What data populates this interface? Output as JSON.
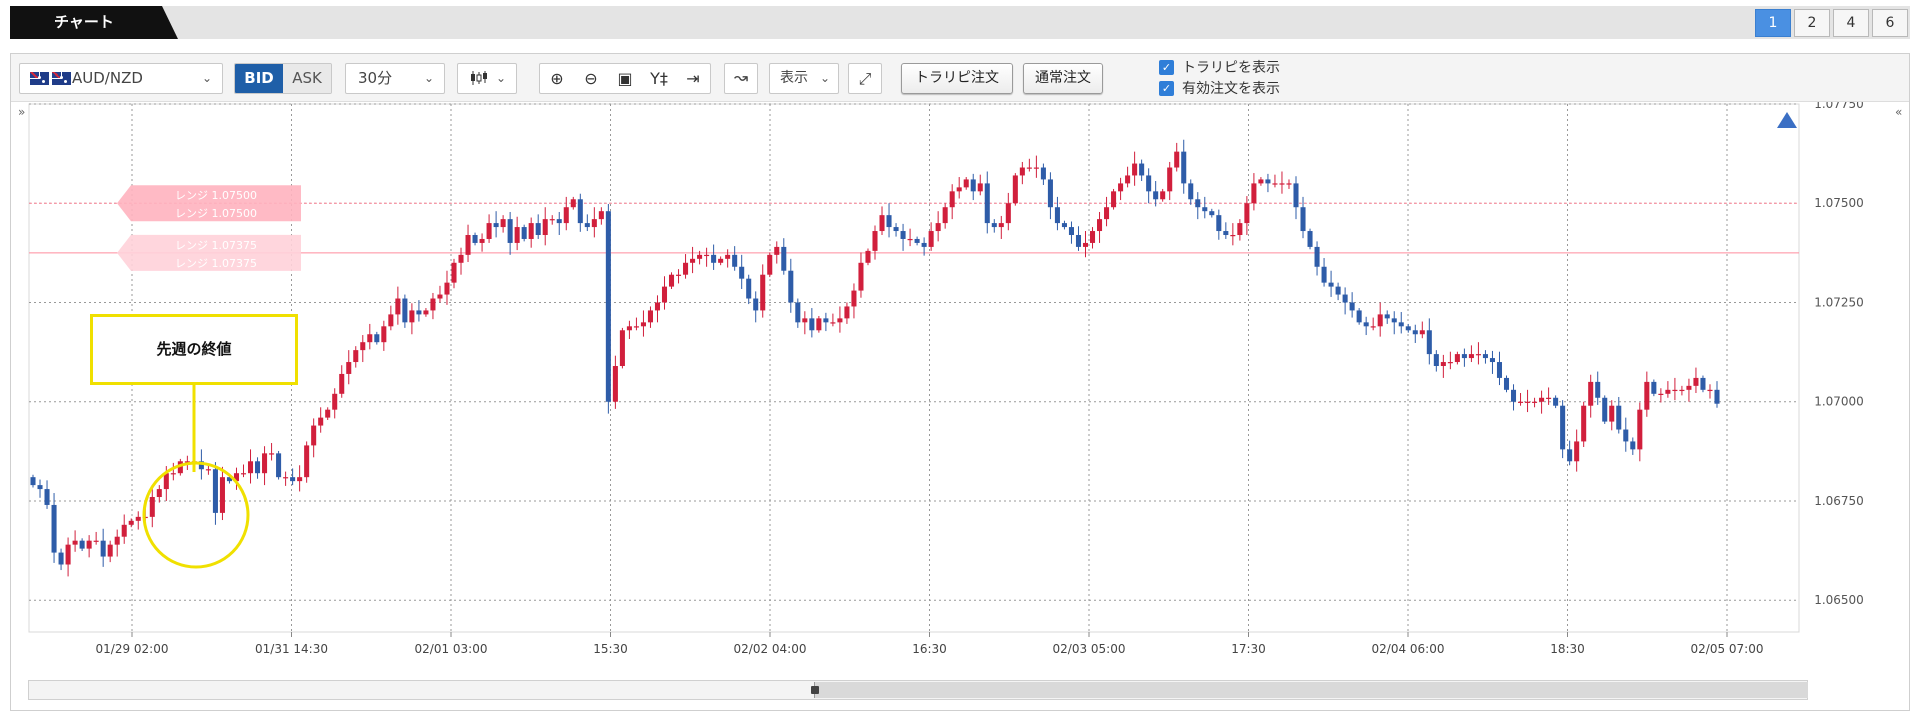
{
  "title_tab": "チャート",
  "layout_buttons": [
    "1",
    "2",
    "4",
    "6"
  ],
  "toolbar": {
    "pair": "AUD/NZD",
    "bid_label": "BID",
    "ask_label": "ASK",
    "timeframe": "30分",
    "display_label": "表示",
    "order_buttons": {
      "trail": "トラリピ注文",
      "normal": "通常注文"
    },
    "checkboxes": [
      "トラリピを表示",
      "有効注文を表示"
    ],
    "icons": [
      "zoom-in-icon",
      "zoom-out-icon",
      "fit-icon",
      "y-scale-icon",
      "jump-to-latest-icon"
    ]
  },
  "colors": {
    "up": "#d11f3c",
    "down": "#2e5ca8",
    "range_line": "#ff8c9e",
    "annotation": "#f0e000",
    "active": "#4a90e2"
  },
  "annotation": "先週の終値",
  "range_orders": [
    {
      "price": 1.075,
      "labels": [
        "レンジ 1.07500",
        "レンジ 1.07500"
      ]
    },
    {
      "price": 1.07375,
      "labels": [
        "レンジ 1.07375",
        "レンジ 1.07375"
      ]
    }
  ],
  "chart_data": {
    "type": "candlestick",
    "y_ticks": [
      "1.07750",
      "1.07500",
      "1.07250",
      "1.07000",
      "1.06750",
      "1.06500"
    ],
    "ylim": [
      1.06425,
      1.0775
    ],
    "x_ticks": [
      "01/29 02:00",
      "01/31 14:30",
      "02/01 03:00",
      "15:30",
      "02/02 04:00",
      "16:30",
      "02/03 05:00",
      "17:30",
      "02/04 06:00",
      "18:30",
      "02/05 07:00"
    ],
    "grid": true,
    "last_close": 1.06995,
    "closes": [
      1.0679,
      1.0678,
      1.0674,
      1.0662,
      1.0659,
      1.0664,
      1.0665,
      1.0663,
      1.0665,
      1.0665,
      1.0661,
      1.0664,
      1.0666,
      1.0669,
      1.067,
      1.0671,
      1.0671,
      1.0676,
      1.0678,
      1.0682,
      1.0682,
      1.0685,
      1.0685,
      1.0685,
      1.0683,
      1.0683,
      1.0672,
      1.0681,
      1.068,
      1.0682,
      1.0682,
      1.0685,
      1.0682,
      1.0687,
      1.0687,
      1.0681,
      1.0681,
      1.068,
      1.0681,
      1.0689,
      1.0694,
      1.0696,
      1.0698,
      1.0702,
      1.0707,
      1.071,
      1.0713,
      1.0715,
      1.0717,
      1.0715,
      1.0719,
      1.0722,
      1.0726,
      1.072,
      1.0723,
      1.0722,
      1.0723,
      1.0726,
      1.0727,
      1.073,
      1.0735,
      1.0737,
      1.0742,
      1.074,
      1.0741,
      1.0745,
      1.0744,
      1.0746,
      1.074,
      1.0744,
      1.0741,
      1.0745,
      1.0742,
      1.0746,
      1.0746,
      1.0745,
      1.0749,
      1.0751,
      1.0745,
      1.0744,
      1.0746,
      1.0748,
      1.07,
      1.0709,
      1.0718,
      1.0719,
      1.0719,
      1.072,
      1.0723,
      1.0725,
      1.0729,
      1.0732,
      1.0732,
      1.0735,
      1.0736,
      1.0737,
      1.0737,
      1.0735,
      1.0736,
      1.0737,
      1.0734,
      1.0731,
      1.0726,
      1.0723,
      1.0732,
      1.0737,
      1.0739,
      1.0733,
      1.0725,
      1.072,
      1.0721,
      1.0718,
      1.0721,
      1.072,
      1.072,
      1.0721,
      1.0724,
      1.0728,
      1.0735,
      1.0738,
      1.0743,
      1.0747,
      1.0744,
      1.0743,
      1.0741,
      1.0741,
      1.074,
      1.0739,
      1.0743,
      1.0745,
      1.0749,
      1.0753,
      1.0754,
      1.0756,
      1.0753,
      1.0755,
      1.0745,
      1.0744,
      1.0745,
      1.075,
      1.0757,
      1.0759,
      1.0759,
      1.0759,
      1.0756,
      1.0749,
      1.0745,
      1.0744,
      1.0742,
      1.0739,
      1.074,
      1.0743,
      1.0746,
      1.0749,
      1.0753,
      1.0755,
      1.0757,
      1.076,
      1.0757,
      1.0753,
      1.0751,
      1.0753,
      1.0759,
      1.0763,
      1.0755,
      1.0751,
      1.0749,
      1.0748,
      1.0747,
      1.0743,
      1.0742,
      1.0742,
      1.0745,
      1.075,
      1.0755,
      1.0756,
      1.0755,
      1.0755,
      1.0755,
      1.0755,
      1.0749,
      1.0743,
      1.0739,
      1.0734,
      1.073,
      1.0729,
      1.0727,
      1.0725,
      1.0723,
      1.072,
      1.0719,
      1.0719,
      1.0722,
      1.0721,
      1.072,
      1.0719,
      1.0718,
      1.0717,
      1.0718,
      1.0712,
      1.0709,
      1.071,
      1.071,
      1.0712,
      1.0711,
      1.0712,
      1.0712,
      1.0711,
      1.071,
      1.0706,
      1.0703,
      1.07,
      1.07,
      1.07,
      1.07,
      1.0701,
      1.0701,
      1.0699,
      1.0688,
      1.0685,
      1.069,
      1.0699,
      1.0705,
      1.0701,
      1.0695,
      1.0699,
      1.0693,
      1.069,
      1.0688,
      1.0698,
      1.0705,
      1.0702,
      1.0702,
      1.0703,
      1.0703,
      1.0703,
      1.0704,
      1.0706,
      1.0703,
      1.0703,
      1.06995
    ]
  }
}
